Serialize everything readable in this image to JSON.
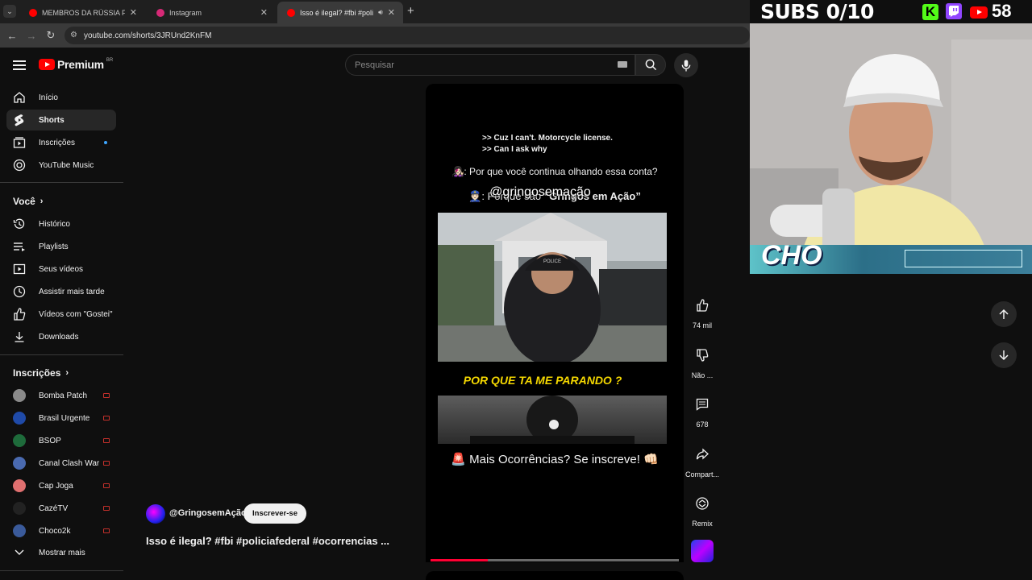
{
  "browser": {
    "tabs": [
      {
        "title": "MEMBROS DA RÚSSIA FORÇAR",
        "favicon": "#ff0000"
      },
      {
        "title": "Instagram",
        "favicon": "#d62976"
      },
      {
        "title": "Isso é ilegal? #fbi #policiafe",
        "favicon": "#ff0000"
      }
    ],
    "new_tab": "+",
    "url": "youtube.com/shorts/3JRUnd2KnFM"
  },
  "yt": {
    "logo_text": "Premium",
    "country": "BR",
    "search_placeholder": "Pesquisar"
  },
  "sidebar": {
    "main": [
      {
        "label": "Início",
        "icon": "home-icon"
      },
      {
        "label": "Shorts",
        "icon": "shorts-icon"
      },
      {
        "label": "Inscrições",
        "icon": "subscriptions-icon"
      },
      {
        "label": "YouTube Music",
        "icon": "music-icon"
      }
    ],
    "you_title": "Você",
    "you": [
      {
        "label": "Histórico",
        "icon": "history-icon"
      },
      {
        "label": "Playlists",
        "icon": "playlists-icon"
      },
      {
        "label": "Seus vídeos",
        "icon": "your-videos-icon"
      },
      {
        "label": "Assistir mais tarde",
        "icon": "watch-later-icon"
      },
      {
        "label": "Vídeos com \"Gostei\"",
        "icon": "liked-icon"
      },
      {
        "label": "Downloads",
        "icon": "download-icon"
      }
    ],
    "subs_title": "Inscrições",
    "subs": [
      {
        "label": "Bomba Patch",
        "color": "#8a8a8a"
      },
      {
        "label": "Brasil Urgente",
        "color": "#1f4aa8"
      },
      {
        "label": "BSOP",
        "color": "#1e6b3b"
      },
      {
        "label": "Canal Clash War",
        "color": "#4a6ab0"
      },
      {
        "label": "Cap Joga",
        "color": "#e07070"
      },
      {
        "label": "CazéTV",
        "color": "#222222"
      },
      {
        "label": "Choco2k",
        "color": "#3a5a9a"
      }
    ],
    "show_more": "Mostrar mais"
  },
  "short": {
    "caption_1": ">> Cuz I can't. Motorcycle license.",
    "caption_2": ">> Can I ask why",
    "question": ": Por que você continua olhando essa conta?",
    "answer_prefix": ": Porque são ",
    "answer_bold": "“Gringos em Ação”",
    "handle_overlay": "@gringosemação",
    "yellow_text": "POR QUE TA ME PARANDO ?",
    "cta": "Mais Ocorrências? Se inscreve!",
    "progress": 0.23,
    "channel": "@GringosemAção",
    "subscribe": "Inscrever-se",
    "title": "Isso é ilegal? #fbi #policiafederal #ocorrencias ..."
  },
  "actions": {
    "like": "74 mil",
    "dislike": "Não ...",
    "comments": "678",
    "share": "Compart...",
    "remix": "Remix"
  },
  "stream": {
    "subs_goal": "SUBS 0/10",
    "kick": "K",
    "viewers": "58",
    "streamer_name": "CHO"
  }
}
